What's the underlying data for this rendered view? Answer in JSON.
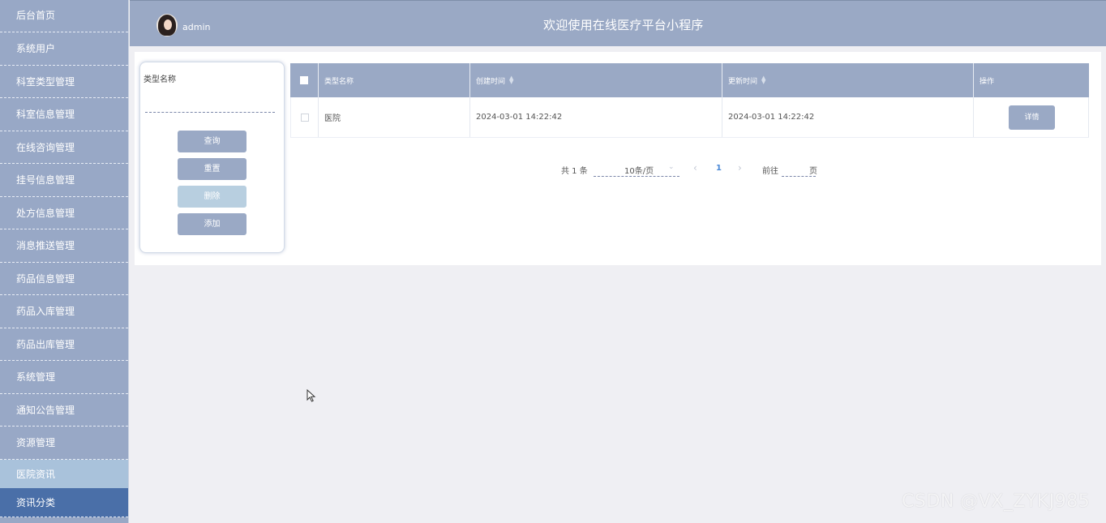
{
  "sidebar": {
    "items": [
      {
        "label": "后台首页"
      },
      {
        "label": "系统用户"
      },
      {
        "label": "科室类型管理"
      },
      {
        "label": "科室信息管理"
      },
      {
        "label": "在线咨询管理"
      },
      {
        "label": "挂号信息管理"
      },
      {
        "label": "处方信息管理"
      },
      {
        "label": "消息推送管理"
      },
      {
        "label": "药品信息管理"
      },
      {
        "label": "药品入库管理"
      },
      {
        "label": "药品出库管理"
      },
      {
        "label": "系统管理"
      },
      {
        "label": "通知公告管理"
      },
      {
        "label": "资源管理"
      },
      {
        "label": "医院资讯"
      },
      {
        "label": "资讯分类"
      }
    ]
  },
  "header": {
    "username": "admin",
    "title": "欢迎使用在线医疗平台小程序"
  },
  "search": {
    "label": "类型名称",
    "value": "",
    "buttons": {
      "query": "查询",
      "reset": "重置",
      "delete": "删除",
      "add": "添加"
    }
  },
  "table": {
    "headers": {
      "name": "类型名称",
      "created": "创建时间",
      "updated": "更新时间",
      "actions": "操作"
    },
    "rows": [
      {
        "name": "医院",
        "created": "2024-03-01 14:22:42",
        "updated": "2024-03-01 14:22:42",
        "action_label": "详情"
      }
    ]
  },
  "pagination": {
    "total_text": "共 1 条",
    "page_size": "10条/页",
    "current_page": "1",
    "goto_label": "前往",
    "goto_value": "",
    "goto_suffix": "页"
  },
  "watermark": "CSDN @VX_ZYKJ985",
  "colors": {
    "primary": "#9aa9c5",
    "active_menu": "#4a6fa8",
    "open_menu": "#a9c2db",
    "page_link": "#4a88d6"
  }
}
